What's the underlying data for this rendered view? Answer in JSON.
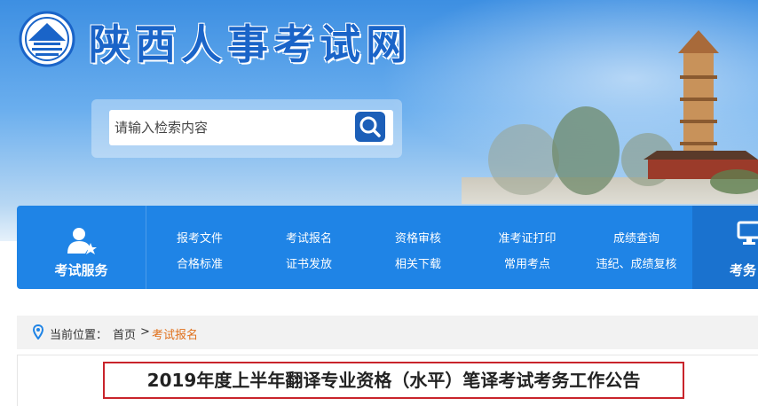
{
  "site": {
    "title": "陕西人事考试网"
  },
  "search": {
    "placeholder": "请输入检索内容"
  },
  "nav": {
    "service_label": "考试服务",
    "items": [
      {
        "top": "报考文件",
        "bottom": "合格标准"
      },
      {
        "top": "考试报名",
        "bottom": "证书发放"
      },
      {
        "top": "资格审核",
        "bottom": "相关下载"
      },
      {
        "top": "准考证打印",
        "bottom": "常用考点"
      },
      {
        "top": "成绩查询",
        "bottom": "违纪、成绩复核"
      }
    ],
    "right_label": "考务"
  },
  "breadcrumb": {
    "prefix": "当前位置：",
    "home": "首页",
    "separator": ">",
    "current": "考试报名"
  },
  "article": {
    "title": "2019年度上半年翻译专业资格（水平）笔译考试考务工作公告"
  },
  "colors": {
    "brand_blue": "#1f84e6",
    "title_blue": "#1a64c8",
    "highlight_red": "#c9242b",
    "breadcrumb_current": "#e0701b"
  }
}
